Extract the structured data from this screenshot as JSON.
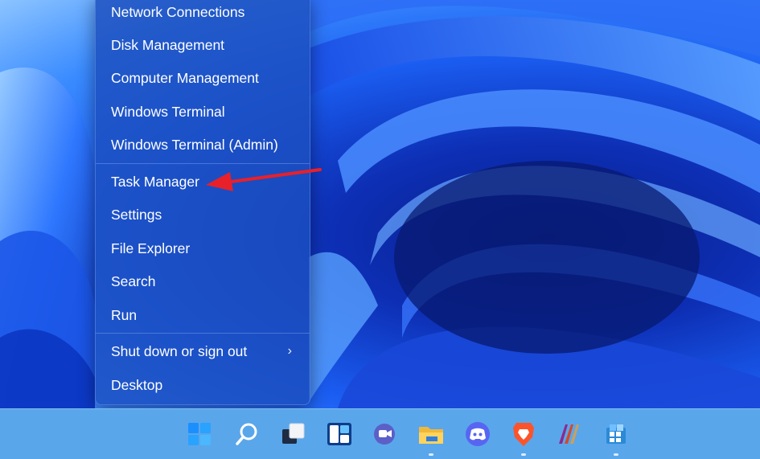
{
  "menu": {
    "items": [
      {
        "label": "Network Connections"
      },
      {
        "label": "Disk Management"
      },
      {
        "label": "Computer Management"
      },
      {
        "label": "Windows Terminal"
      },
      {
        "label": "Windows Terminal (Admin)"
      },
      {
        "label": "Task Manager"
      },
      {
        "label": "Settings"
      },
      {
        "label": "File Explorer"
      },
      {
        "label": "Search"
      },
      {
        "label": "Run"
      },
      {
        "label": "Shut down or sign out",
        "submenu": true
      },
      {
        "label": "Desktop"
      }
    ],
    "submenu_glyph": "›"
  },
  "annotation": {
    "target": "Task Manager",
    "color": "#e8202a"
  },
  "taskbar": {
    "icons": [
      "start-icon",
      "search-icon",
      "task-view-icon",
      "widgets-icon",
      "teams-chat-icon",
      "file-explorer-icon",
      "discord-icon",
      "brave-icon",
      "winrar-icon",
      "app-icon"
    ],
    "running": [
      "file-explorer-icon",
      "brave-icon",
      "app-icon"
    ]
  }
}
